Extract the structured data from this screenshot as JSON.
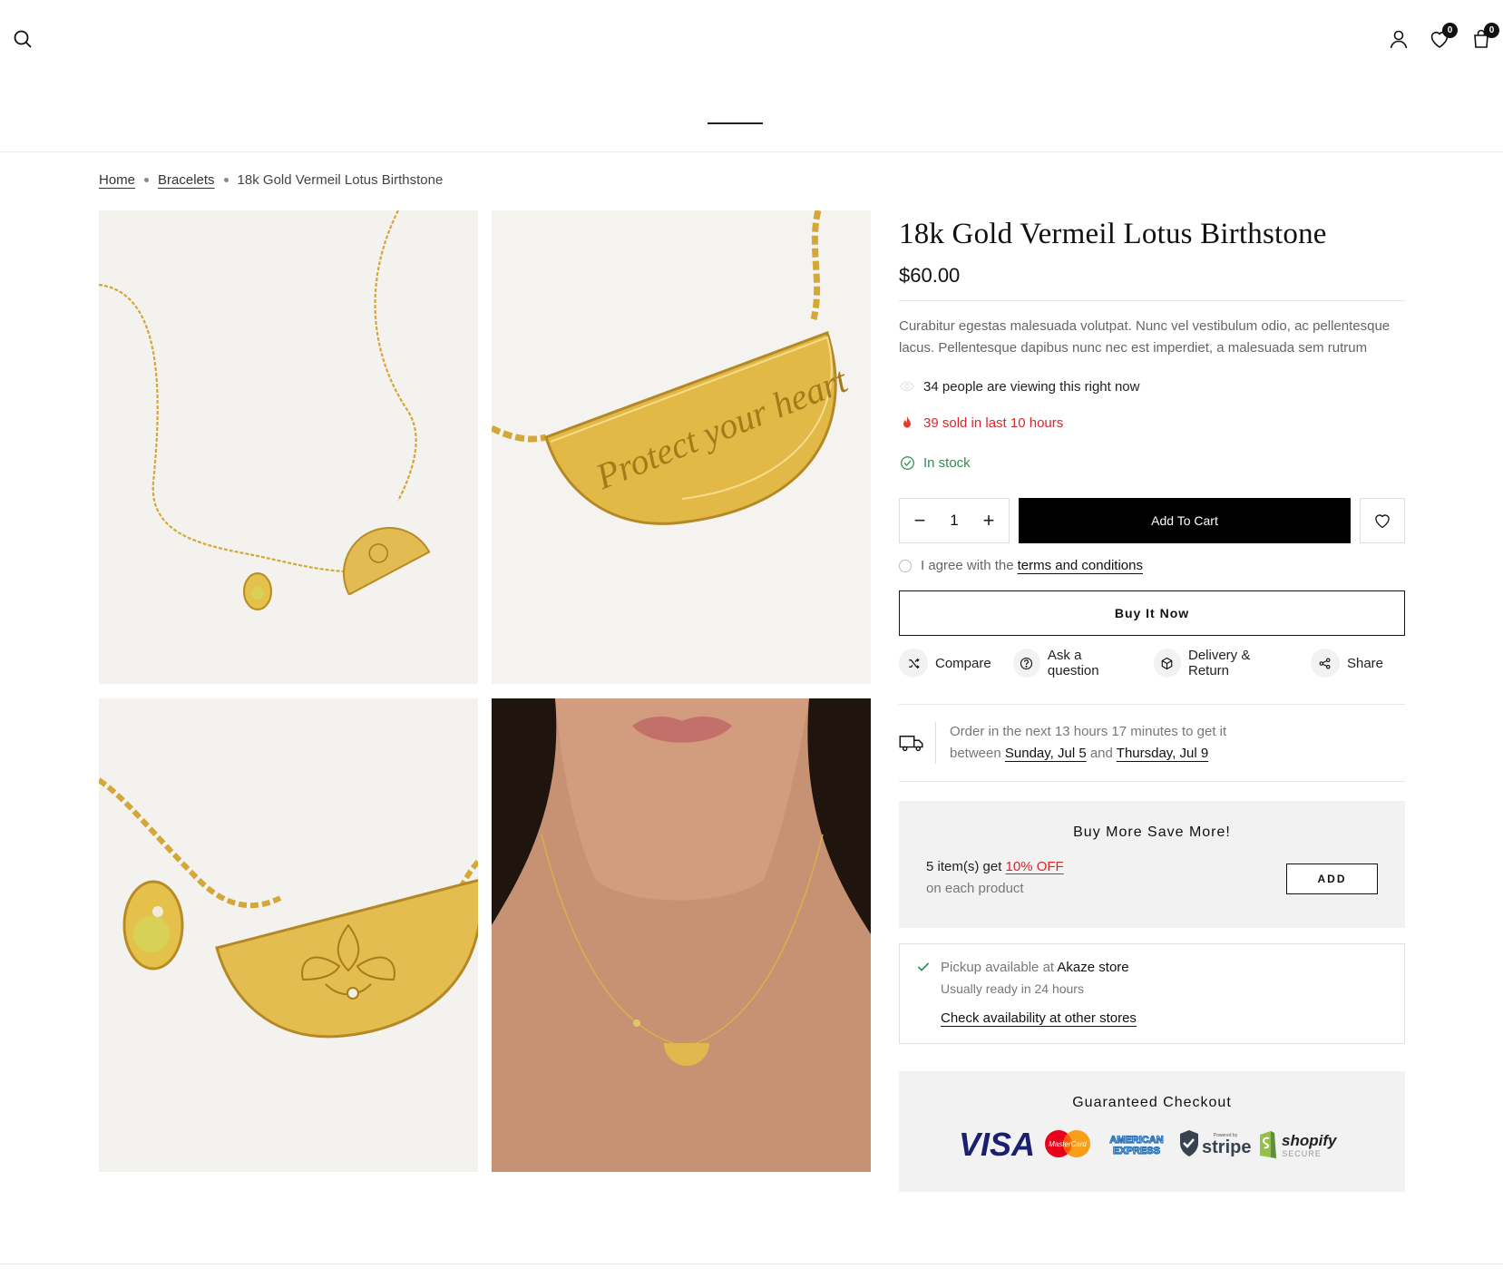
{
  "header": {
    "wishlist_count": "0",
    "cart_count": "0"
  },
  "breadcrumb": {
    "home": "Home",
    "category": "Bracelets",
    "current": "18k Gold Vermeil Lotus Birthstone"
  },
  "gallery": {
    "engraving": "Protect your heart"
  },
  "product": {
    "title": "18k Gold Vermeil Lotus Birthstone",
    "price": "$60.00",
    "description": "Curabitur egestas malesuada volutpat. Nunc vel vestibulum odio, ac pellentesque lacus. Pellentesque dapibus nunc nec est imperdiet, a malesuada sem rutrum",
    "viewing": "34 people are viewing this right now",
    "sold": "39 sold in last 10 hours",
    "stock": "In stock",
    "quantity": "1",
    "add_to_cart": "Add To Cart",
    "agree_prefix": "I agree with the",
    "agree_link": "terms and conditions",
    "buy_now": "Buy It Now"
  },
  "actions": [
    {
      "label": "Compare",
      "icon": "shuffle-icon"
    },
    {
      "label": "Ask a question",
      "icon": "question-icon"
    },
    {
      "label": "Delivery & Return",
      "icon": "box-icon"
    },
    {
      "label": "Share",
      "icon": "share-icon"
    }
  ],
  "delivery": {
    "line1": "Order in the next 13 hours 17 minutes to get it",
    "between": "between",
    "date1": "Sunday, Jul 5",
    "and": "and",
    "date2": "Thursday, Jul 9"
  },
  "bundle": {
    "title": "Buy More Save More!",
    "prefix": "5 item(s) get",
    "offer": "10% OFF",
    "sub": "on each product",
    "button": "ADD"
  },
  "pickup": {
    "prefix": "Pickup available at",
    "store": "Akaze store",
    "ready": "Usually ready in 24 hours",
    "link": "Check availability at other stores"
  },
  "checkout": {
    "title": "Guaranteed Checkout",
    "visa": "VISA",
    "mastercard": "MasterCard",
    "amex_1": "AMERICAN",
    "amex_2": "EXPRESS",
    "stripe_small": "Powered by",
    "stripe": "stripe",
    "shopify": "shopify",
    "shopify_small": "SECURE"
  },
  "colors": {
    "accent": "#000000",
    "sale": "#d8272b",
    "stock": "#2e8b57",
    "gold": "#d9ae3d"
  }
}
